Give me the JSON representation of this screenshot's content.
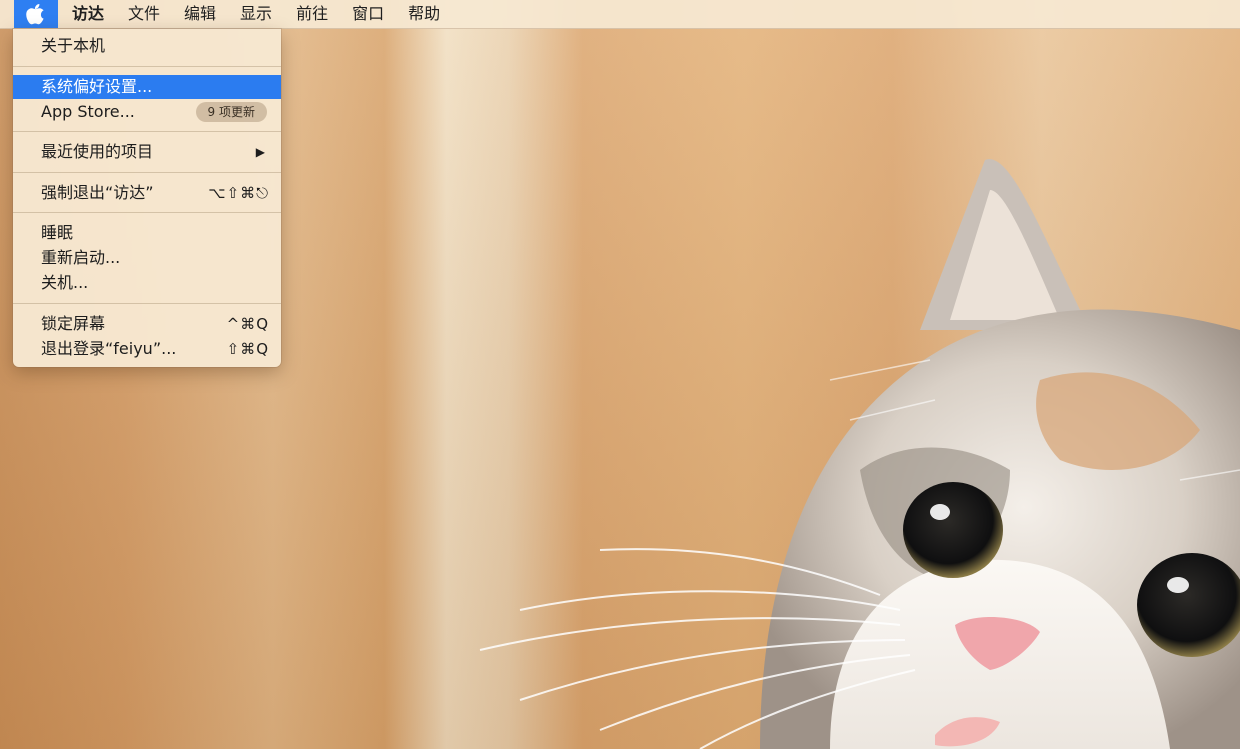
{
  "menubar": {
    "apple_icon": "apple-logo-icon",
    "app_name": "访达",
    "items": [
      "文件",
      "编辑",
      "显示",
      "前往",
      "窗口",
      "帮助"
    ]
  },
  "apple_menu": {
    "about": "关于本机",
    "system_prefs": "系统偏好设置...",
    "app_store": "App Store...",
    "app_store_badge": "9 项更新",
    "recent_items": "最近使用的项目",
    "force_quit": "强制退出“访达”",
    "force_quit_shortcut": "⌥⇧⌘⎋",
    "sleep": "睡眠",
    "restart": "重新启动...",
    "shutdown": "关机...",
    "lock_screen": "锁定屏幕",
    "lock_screen_shortcut": "^⌘Q",
    "logout": "退出登录“feiyu”...",
    "logout_shortcut": "⇧⌘Q"
  },
  "colors": {
    "selection": "#2b7cf0",
    "menu_bg": "#f7e8d1"
  }
}
